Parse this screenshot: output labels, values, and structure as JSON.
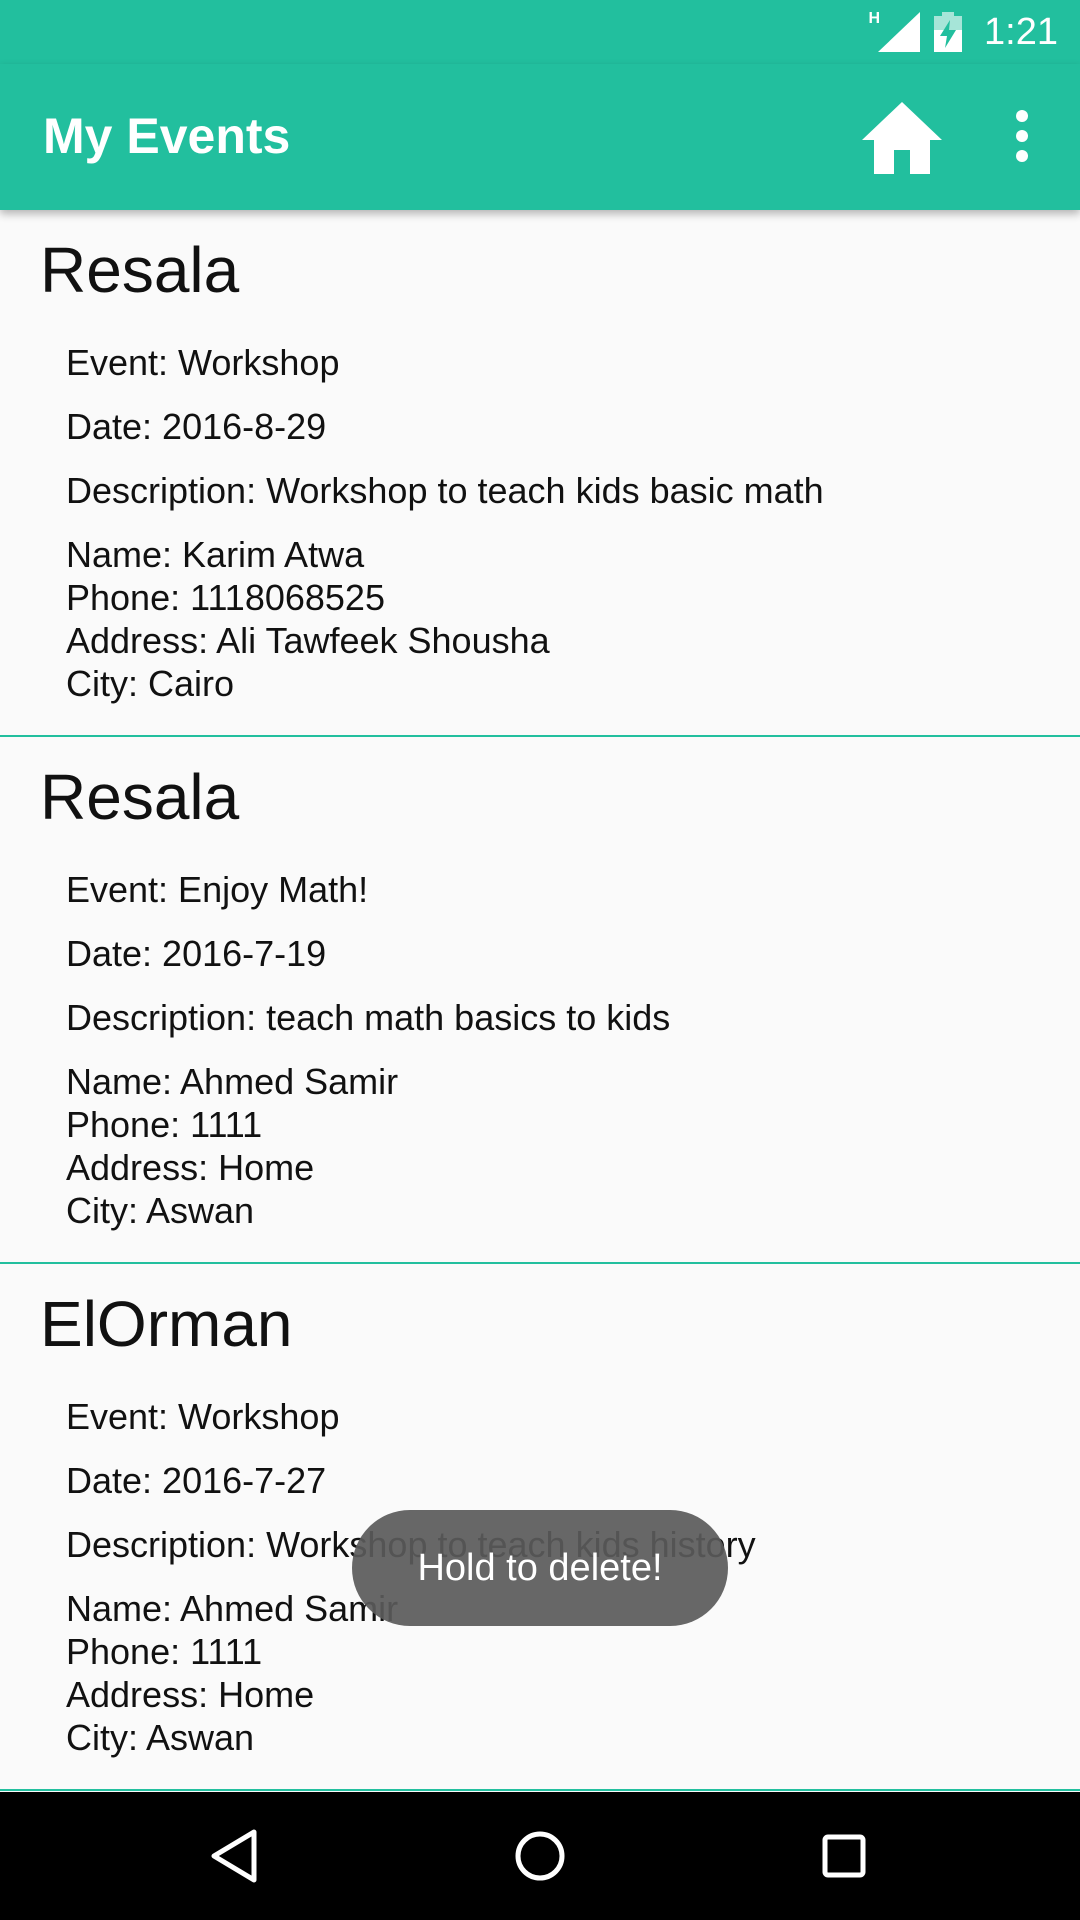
{
  "status_bar": {
    "time": "1:21",
    "network_label": "H"
  },
  "app_bar": {
    "title": "My Events",
    "home_icon": "home-icon",
    "menu_icon": "more-vert-icon"
  },
  "events": [
    {
      "organization": "Resala",
      "event": "Event: Workshop",
      "date": "Date: 2016-8-29",
      "description": "Description: Workshop to teach kids basic math",
      "name": "Name: Karim Atwa",
      "phone": "Phone: 1118068525",
      "address": "Address: Ali Tawfeek Shousha",
      "city": "City: Cairo"
    },
    {
      "organization": "Resala",
      "event": "Event: Enjoy Math!",
      "date": "Date: 2016-7-19",
      "description": "Description: teach math basics to kids",
      "name": "Name: Ahmed Samir",
      "phone": "Phone: 1111",
      "address": "Address: Home",
      "city": "City: Aswan"
    },
    {
      "organization": "ElOrman",
      "event": "Event: Workshop",
      "date": "Date: 2016-7-27",
      "description": "Description: Workshop to teach kids history",
      "name": "Name: Ahmed Samir",
      "phone": "Phone: 1111",
      "address": "Address: Home",
      "city": "City: Aswan"
    }
  ],
  "toast": {
    "text": "Hold to delete!"
  },
  "nav_bar": {
    "back_icon": "back-icon",
    "home_icon": "home-circle-icon",
    "recents_icon": "recents-icon"
  },
  "colors": {
    "primary": "#22bf9e",
    "divider": "#22bf9e",
    "background": "#fafafa"
  }
}
